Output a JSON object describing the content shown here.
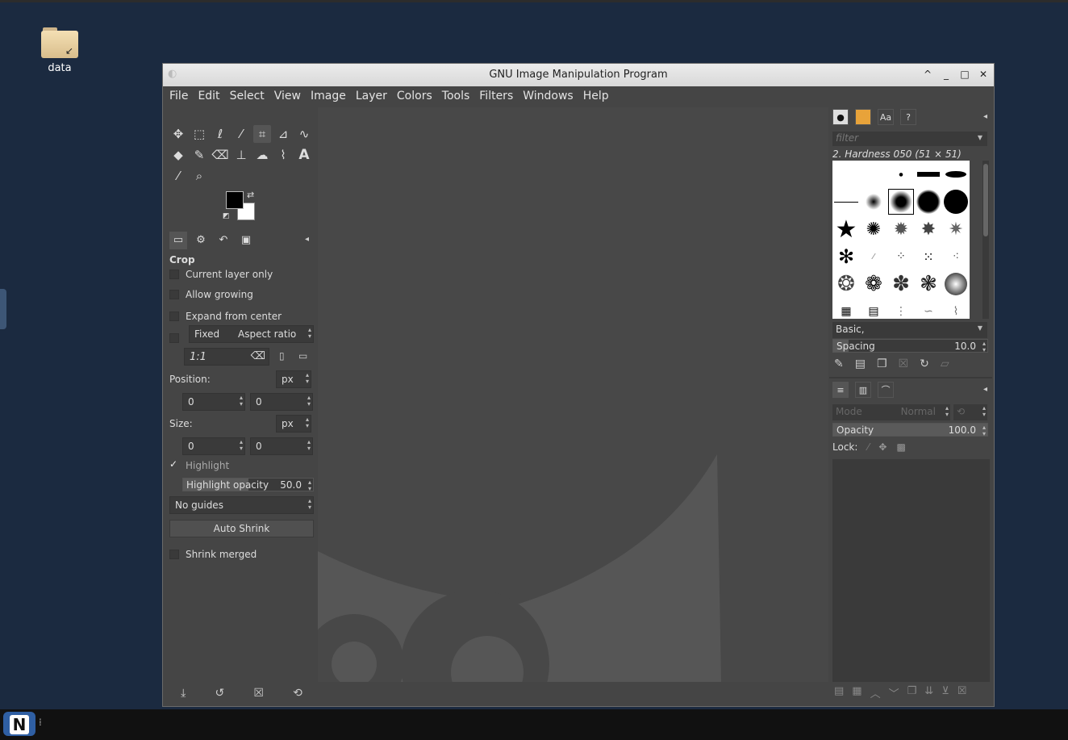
{
  "desktop": {
    "icon_label": "data",
    "taskbar_logo": "N"
  },
  "window": {
    "title": "GNU Image Manipulation Program"
  },
  "menu": [
    "File",
    "Edit",
    "Select",
    "View",
    "Image",
    "Layer",
    "Colors",
    "Tools",
    "Filters",
    "Windows",
    "Help"
  ],
  "tool_options": {
    "title": "Crop",
    "current_layer_only": "Current layer only",
    "allow_growing": "Allow growing",
    "expand_from_center": "Expand from center",
    "fixed": "Fixed",
    "aspect_ratio": "Aspect ratio",
    "ratio_value": "1:1",
    "position_label": "Position:",
    "position_unit": "px",
    "position_x": "0",
    "position_y": "0",
    "size_label": "Size:",
    "size_unit": "px",
    "size_w": "0",
    "size_h": "0",
    "highlight": "Highlight",
    "highlight_opacity_label": "Highlight opacity",
    "highlight_opacity_value": "50.0",
    "highlight_opacity_fraction": 0.5,
    "guides": "No guides",
    "auto_shrink": "Auto Shrink",
    "shrink_merged": "Shrink merged"
  },
  "brushes": {
    "filter_placeholder": "filter",
    "selected_brush": "2. Hardness 050 (51 × 51)",
    "tag": "Basic,",
    "spacing_label": "Spacing",
    "spacing_value": "10.0"
  },
  "layers": {
    "mode_label": "Mode",
    "mode_value": "Normal",
    "opacity_label": "Opacity",
    "opacity_value": "100.0",
    "lock_label": "Lock:"
  },
  "colors": {
    "fg": "#000000",
    "bg": "#ffffff",
    "desktop": "#1b2a40",
    "panel": "#454545"
  }
}
